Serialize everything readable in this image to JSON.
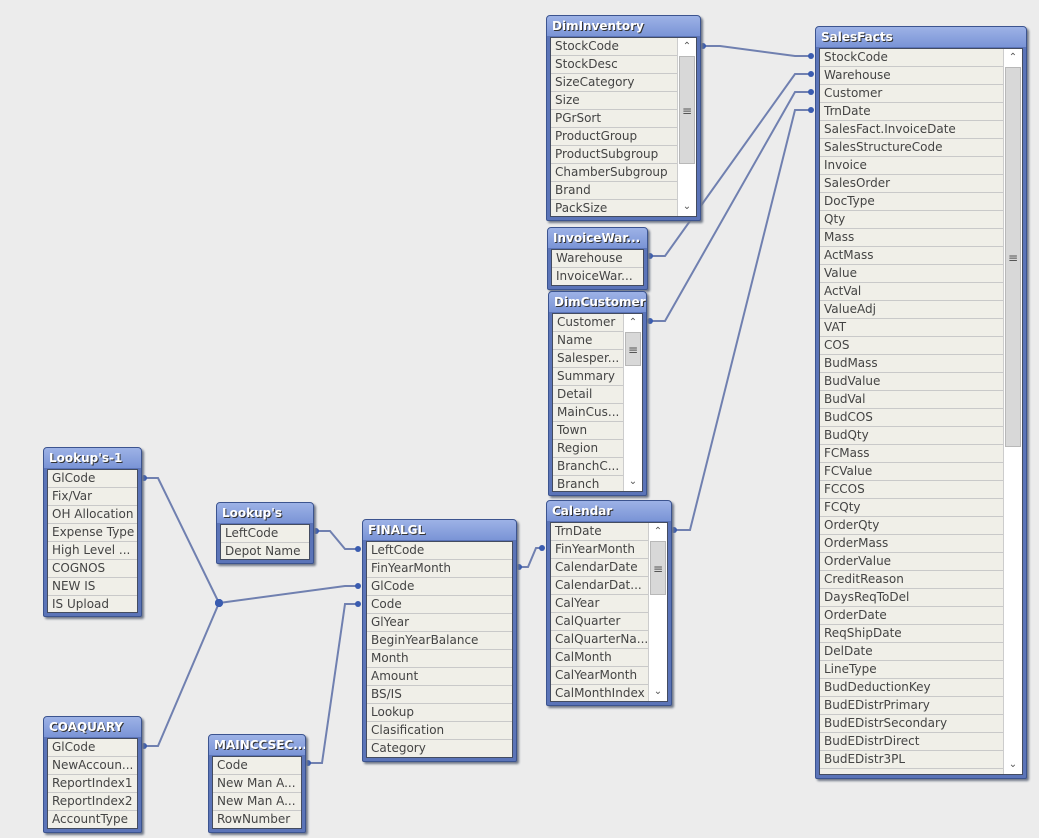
{
  "tables": [
    {
      "id": "diminventory",
      "title": "DimInventory",
      "fields": [
        "StockCode",
        "StockDesc",
        "SizeCategory",
        "Size",
        "PGrSort",
        "ProductGroup",
        "ProductSubgroup",
        "ChamberSubgroup",
        "Brand",
        "PackSize"
      ],
      "scroll": true
    },
    {
      "id": "invoicewarehouse",
      "title": "InvoiceWar...",
      "fields": [
        "Warehouse",
        "InvoiceWar..."
      ],
      "scroll": false
    },
    {
      "id": "dimcustomer",
      "title": "DimCustomer",
      "fields": [
        "Customer",
        "Name",
        "Salesper...",
        "Summary",
        "Detail",
        "MainCus...",
        "Town",
        "Region",
        "BranchC...",
        "Branch"
      ],
      "scroll": true
    },
    {
      "id": "salesfacts",
      "title": "SalesFacts",
      "fields": [
        "StockCode",
        "Warehouse",
        "Customer",
        "TrnDate",
        "SalesFact.InvoiceDate",
        "SalesStructureCode",
        "Invoice",
        "SalesOrder",
        "DocType",
        "Qty",
        "Mass",
        "ActMass",
        "Value",
        "ActVal",
        "ValueAdj",
        "VAT",
        "COS",
        "BudMass",
        "BudValue",
        "BudVal",
        "BudCOS",
        "BudQty",
        "FCMass",
        "FCValue",
        "FCCOS",
        "FCQty",
        "OrderQty",
        "OrderMass",
        "OrderValue",
        "CreditReason",
        "DaysReqToDel",
        "OrderDate",
        "ReqShipDate",
        "DelDate",
        "LineType",
        "BudDeductionKey",
        "BudEDistrPrimary",
        "BudEDistrSecondary",
        "BudEDistrDirect",
        "BudEDistr3PL"
      ],
      "scroll": true
    },
    {
      "id": "calendar",
      "title": "Calendar",
      "fields": [
        "TrnDate",
        "FinYearMonth",
        "CalendarDate",
        "CalendarDat...",
        "CalYear",
        "CalQuarter",
        "CalQuarterNa...",
        "CalMonth",
        "CalYearMonth",
        "CalMonthIndex"
      ],
      "scroll": true
    },
    {
      "id": "finalgl",
      "title": "FINALGL",
      "fields": [
        "LeftCode",
        "FinYearMonth",
        "GlCode",
        "Code",
        "GlYear",
        "BeginYearBalance",
        "Month",
        "Amount",
        "BS/IS",
        "Lookup",
        "Clasification",
        "Category"
      ],
      "scroll": false
    },
    {
      "id": "lookups",
      "title": "Lookup's",
      "fields": [
        "LeftCode",
        "Depot Name"
      ],
      "scroll": false
    },
    {
      "id": "lookups1",
      "title": "Lookup's-1",
      "fields": [
        "GlCode",
        "Fix/Var",
        "OH Allocation",
        "Expense Type",
        "High Level ...",
        "COGNOS",
        "NEW IS",
        "IS Upload"
      ],
      "scroll": false
    },
    {
      "id": "coaquary",
      "title": "COAQUARY",
      "fields": [
        "GlCode",
        "NewAccoun...",
        "ReportIndex1",
        "ReportIndex2",
        "AccountType"
      ],
      "scroll": false
    },
    {
      "id": "mainccsec",
      "title": "MAINCCSEC...",
      "fields": [
        "Code",
        "New Man A...",
        "New Man A...",
        "RowNumber"
      ],
      "scroll": false
    }
  ],
  "colors": {
    "header": "#7a94d6",
    "link": "#7080b0",
    "background": "#ececec"
  }
}
